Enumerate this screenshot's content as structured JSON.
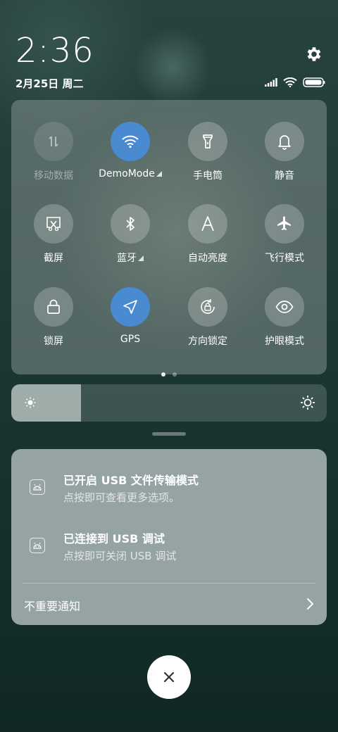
{
  "status_bar": {
    "time": "2:36",
    "date": "2月25日 周二"
  },
  "toggles": [
    {
      "label": "移动数据",
      "icon": "mobile-data-icon",
      "state": "disabled"
    },
    {
      "label": "DemoMode",
      "icon": "wifi-icon",
      "state": "on",
      "expand": true
    },
    {
      "label": "手电筒",
      "icon": "flashlight-icon",
      "state": "off"
    },
    {
      "label": "静音",
      "icon": "bell-icon",
      "state": "off"
    },
    {
      "label": "截屏",
      "icon": "screenshot-icon",
      "state": "off"
    },
    {
      "label": "蓝牙",
      "icon": "bluetooth-icon",
      "state": "off",
      "expand": true
    },
    {
      "label": "自动亮度",
      "icon": "auto-brightness-icon",
      "state": "off"
    },
    {
      "label": "飞行模式",
      "icon": "airplane-icon",
      "state": "off"
    },
    {
      "label": "锁屏",
      "icon": "lock-icon",
      "state": "off"
    },
    {
      "label": "GPS",
      "icon": "location-arrow-icon",
      "state": "on"
    },
    {
      "label": "方向锁定",
      "icon": "rotation-lock-icon",
      "state": "off"
    },
    {
      "label": "护眼模式",
      "icon": "eye-icon",
      "state": "off"
    }
  ],
  "pages": {
    "count": 2,
    "current": 1
  },
  "brightness": {
    "level": 0.22
  },
  "notifications": [
    {
      "title": "已开启 USB 文件传输模式",
      "subtitle": "点按即可查看更多选项。",
      "icon": "android-icon"
    },
    {
      "title": "已连接到 USB 调试",
      "subtitle": "点按即可关闭 USB 调试",
      "icon": "android-icon"
    }
  ],
  "notifications_footer": "不重要通知",
  "colors": {
    "accent": "#4a8ad1"
  }
}
